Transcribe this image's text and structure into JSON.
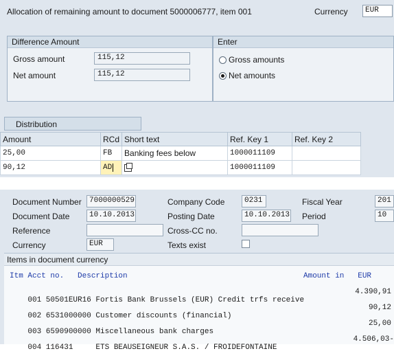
{
  "header": {
    "title": "Allocation of remaining amount to document 5000006777, item 001",
    "currency_label": "Currency",
    "currency_value": "EUR"
  },
  "difference": {
    "title": "Difference Amount",
    "gross_label": "Gross amount",
    "gross_value": "115,12",
    "net_label": "Net amount",
    "net_value": "115,12"
  },
  "enter": {
    "title": "Enter",
    "options": [
      {
        "label": "Gross amounts",
        "selected": false
      },
      {
        "label": "Net amounts",
        "selected": true
      }
    ]
  },
  "distribution": {
    "title": "Distribution",
    "columns": [
      "Amount",
      "RCd",
      "Short text",
      "Ref. Key 1",
      "Ref. Key 2"
    ],
    "rows": [
      {
        "amount": "25,00",
        "rcd": "FB",
        "short_text": "Banking fees below",
        "ref1": "1000011109",
        "ref2": ""
      },
      {
        "amount": "90,12",
        "rcd": "AD",
        "short_text": "",
        "ref1": "1000011109",
        "ref2": ""
      }
    ]
  },
  "document": {
    "doc_number_label": "Document Number",
    "doc_number": "7000000529",
    "company_code_label": "Company Code",
    "company_code": "0231",
    "fiscal_year_label": "Fiscal Year",
    "fiscal_year": "201",
    "doc_date_label": "Document Date",
    "doc_date": "10.10.2013",
    "posting_date_label": "Posting Date",
    "posting_date": "10.10.2013",
    "period_label": "Period",
    "period": "10",
    "reference_label": "Reference",
    "reference": "",
    "cross_cc_label": "Cross-CC no.",
    "cross_cc": "",
    "currency_label": "Currency",
    "currency": "EUR",
    "texts_exist_label": "Texts exist",
    "texts_exist": false
  },
  "items": {
    "title": "Items in document currency",
    "header_left": "Itm Acct no.   Description",
    "header_right": "Amount in   EUR",
    "rows": [
      {
        "left": "001 50501EUR16 Fortis Bank Brussels (EUR) Credit trfs receive",
        "amount": "4.390,91"
      },
      {
        "left": "002 6531000000 Customer discounts (financial)",
        "amount": "90,12"
      },
      {
        "left": "003 6590900000 Miscellaneous bank charges",
        "amount": "25,00"
      },
      {
        "left": "004 116431     ETS BEAUSEIGNEUR S.A.S. / FROIDEFONTAINE",
        "amount": "4.506,03-"
      }
    ]
  }
}
